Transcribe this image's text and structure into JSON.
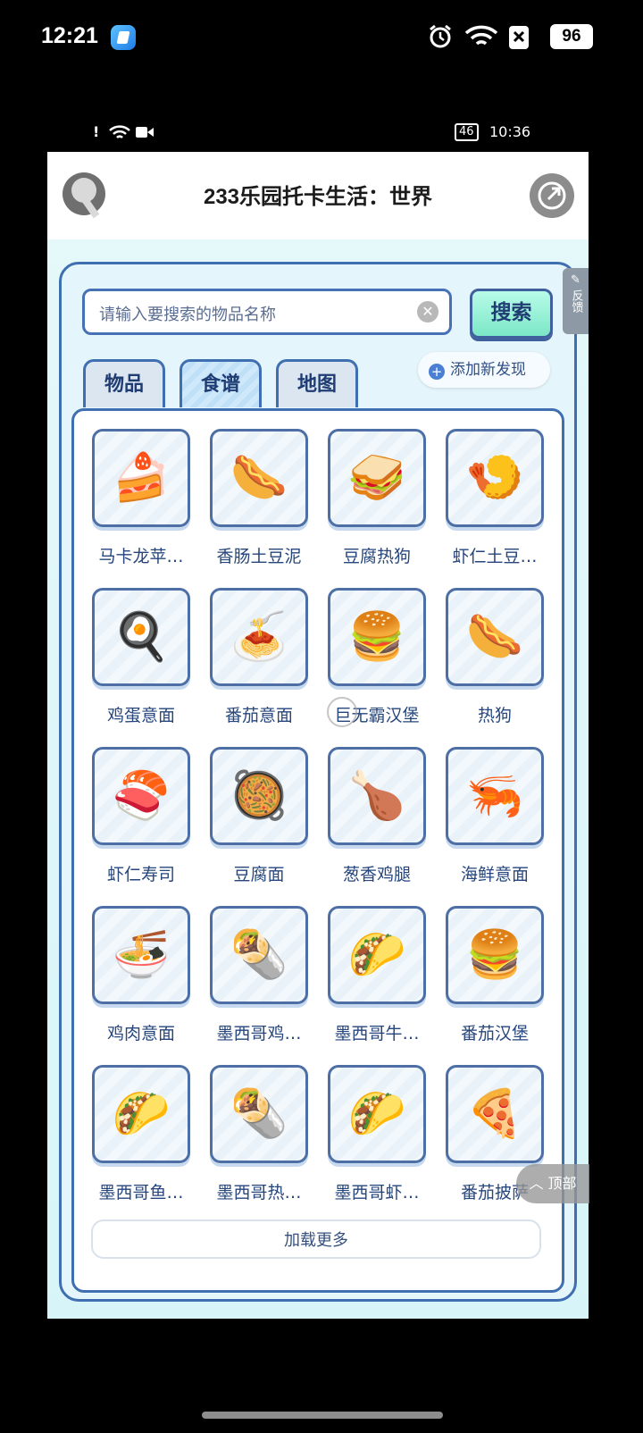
{
  "outer_status": {
    "time": "12:21",
    "battery": "96",
    "icons": [
      "app-icon",
      "alarm-icon",
      "wifi-icon",
      "no-sim-icon",
      "battery-icon"
    ]
  },
  "inner_status": {
    "time": "10:36",
    "battery": "46"
  },
  "header": {
    "title": "233乐园托卡生活：世界"
  },
  "search": {
    "placeholder": "请输入要搜索的物品名称",
    "button": "搜索"
  },
  "feedback": {
    "label": "反馈"
  },
  "tabs": [
    {
      "label": "物品",
      "active": false
    },
    {
      "label": "食谱",
      "active": true
    },
    {
      "label": "地图",
      "active": false
    }
  ],
  "add_new": "添加新发现",
  "items": [
    {
      "name": "马卡龙苹…",
      "icon": "🍰"
    },
    {
      "name": "香肠土豆泥",
      "icon": "🌭"
    },
    {
      "name": "豆腐热狗",
      "icon": "🥪"
    },
    {
      "name": "虾仁土豆…",
      "icon": "🍤"
    },
    {
      "name": "鸡蛋意面",
      "icon": "🍳"
    },
    {
      "name": "番茄意面",
      "icon": "🍝"
    },
    {
      "name": "巨无霸汉堡",
      "icon": "🍔"
    },
    {
      "name": "热狗",
      "icon": "🌭"
    },
    {
      "name": "虾仁寿司",
      "icon": "🍣"
    },
    {
      "name": "豆腐面",
      "icon": "🥘"
    },
    {
      "name": "葱香鸡腿",
      "icon": "🍗"
    },
    {
      "name": "海鲜意面",
      "icon": "🦐"
    },
    {
      "name": "鸡肉意面",
      "icon": "🍜"
    },
    {
      "name": "墨西哥鸡…",
      "icon": "🌯"
    },
    {
      "name": "墨西哥牛…",
      "icon": "🌮"
    },
    {
      "name": "番茄汉堡",
      "icon": "🍔"
    },
    {
      "name": "墨西哥鱼…",
      "icon": "🌮"
    },
    {
      "name": "墨西哥热…",
      "icon": "🌯"
    },
    {
      "name": "墨西哥虾…",
      "icon": "🌮"
    },
    {
      "name": "番茄披萨",
      "icon": "🍕"
    }
  ],
  "load_more": "加载更多",
  "to_top": "顶部"
}
